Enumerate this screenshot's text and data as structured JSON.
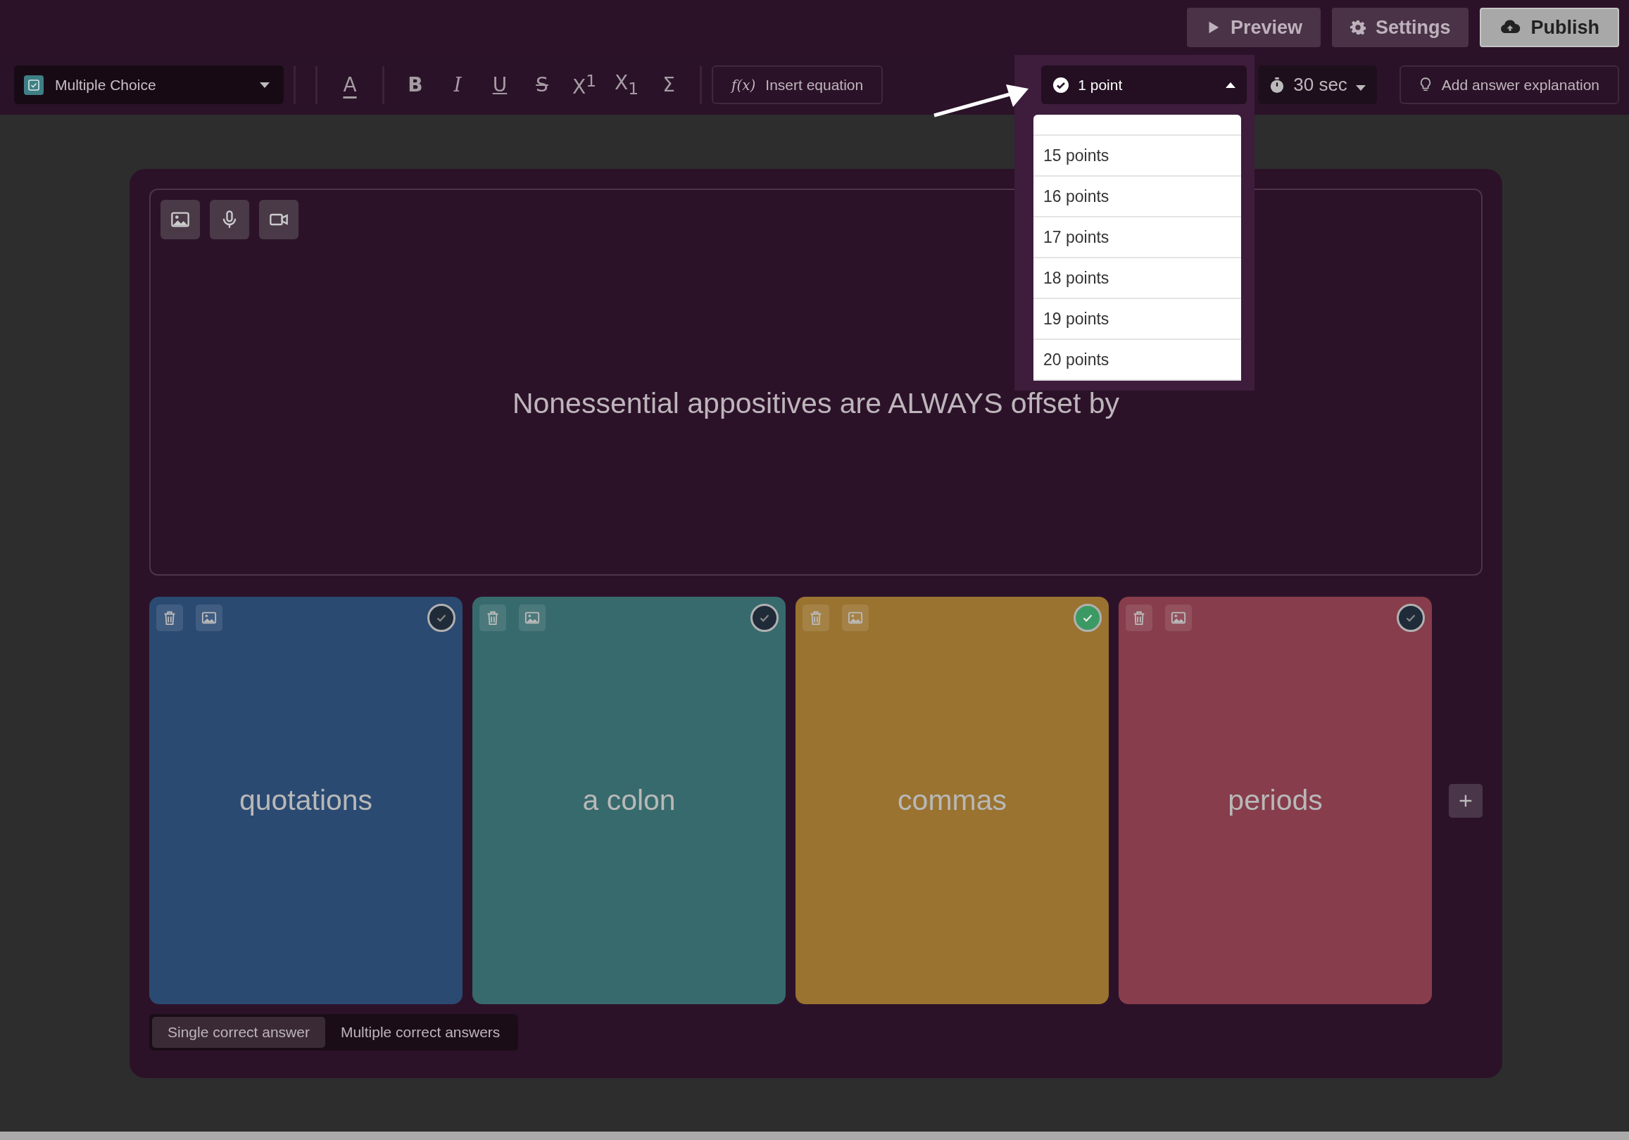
{
  "topbar": {
    "buttons": [
      {
        "label": "Preview",
        "kind": "preview"
      },
      {
        "label": "Settings",
        "kind": "settings"
      },
      {
        "label": "Publish",
        "kind": "publish"
      }
    ]
  },
  "toolbar": {
    "question_type": "Multiple Choice",
    "format_tools": [
      {
        "label": "A",
        "kind": "color"
      },
      {
        "label": "B",
        "kind": "bold"
      },
      {
        "label": "I",
        "kind": "italic"
      },
      {
        "label": "U",
        "kind": "underline"
      },
      {
        "label": "S",
        "kind": "strike"
      },
      {
        "label": "X$^{1}$",
        "kind": "sup"
      },
      {
        "label": "X$_{1}$",
        "kind": "sub"
      },
      {
        "label": "Σ",
        "kind": "sum"
      }
    ],
    "equation": {
      "symbol": "f(x)",
      "label": "Insert equation"
    },
    "points": {
      "value": "1 point",
      "expanded": true,
      "options": [
        {
          "label": "15 points",
          "selected": false
        },
        {
          "label": "16 points",
          "selected": false
        },
        {
          "label": "17 points",
          "selected": false
        },
        {
          "label": "18 points",
          "selected": false
        },
        {
          "label": "19 points",
          "selected": false
        },
        {
          "label": "20 points",
          "selected": false
        }
      ]
    },
    "timer": "30 sec",
    "explanation": "Add answer explanation"
  },
  "question": {
    "text": "Nonessential appositives are ALWAYS offset by"
  },
  "answers": [
    {
      "text": "quotations",
      "color": "#2b4a72",
      "correct": false
    },
    {
      "text": "a colon",
      "color": "#376a6d",
      "correct": false
    },
    {
      "text": "commas",
      "color": "#9a7330",
      "correct": true
    },
    {
      "text": "periods",
      "color": "#873d4b",
      "correct": false
    }
  ],
  "answer_mode": [
    {
      "label": "Single correct answer",
      "selected": true
    },
    {
      "label": "Multiple correct answers",
      "selected": false
    }
  ]
}
